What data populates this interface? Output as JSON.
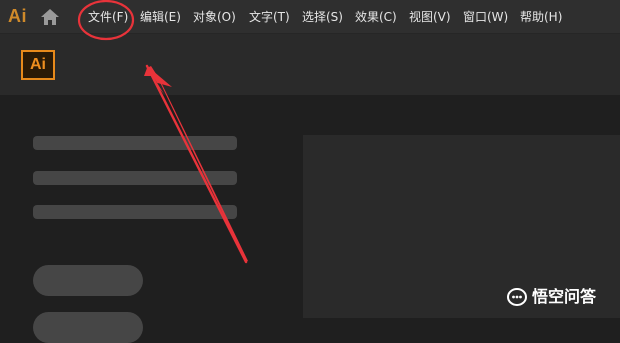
{
  "app": {
    "glyph": "Ai",
    "logo_text": "Ai",
    "accent_color": "#e88a1b",
    "home_icon": "home-icon"
  },
  "menu": [
    {
      "label": "文件(F)"
    },
    {
      "label": "编辑(E)"
    },
    {
      "label": "对象(O)"
    },
    {
      "label": "文字(T)"
    },
    {
      "label": "选择(S)"
    },
    {
      "label": "效果(C)"
    },
    {
      "label": "视图(V)"
    },
    {
      "label": "窗口(W)"
    },
    {
      "label": "帮助(H)"
    }
  ],
  "annotation": {
    "circled_item": "文件(F)",
    "color": "#e8333a"
  },
  "watermark": {
    "text": "悟空问答"
  }
}
